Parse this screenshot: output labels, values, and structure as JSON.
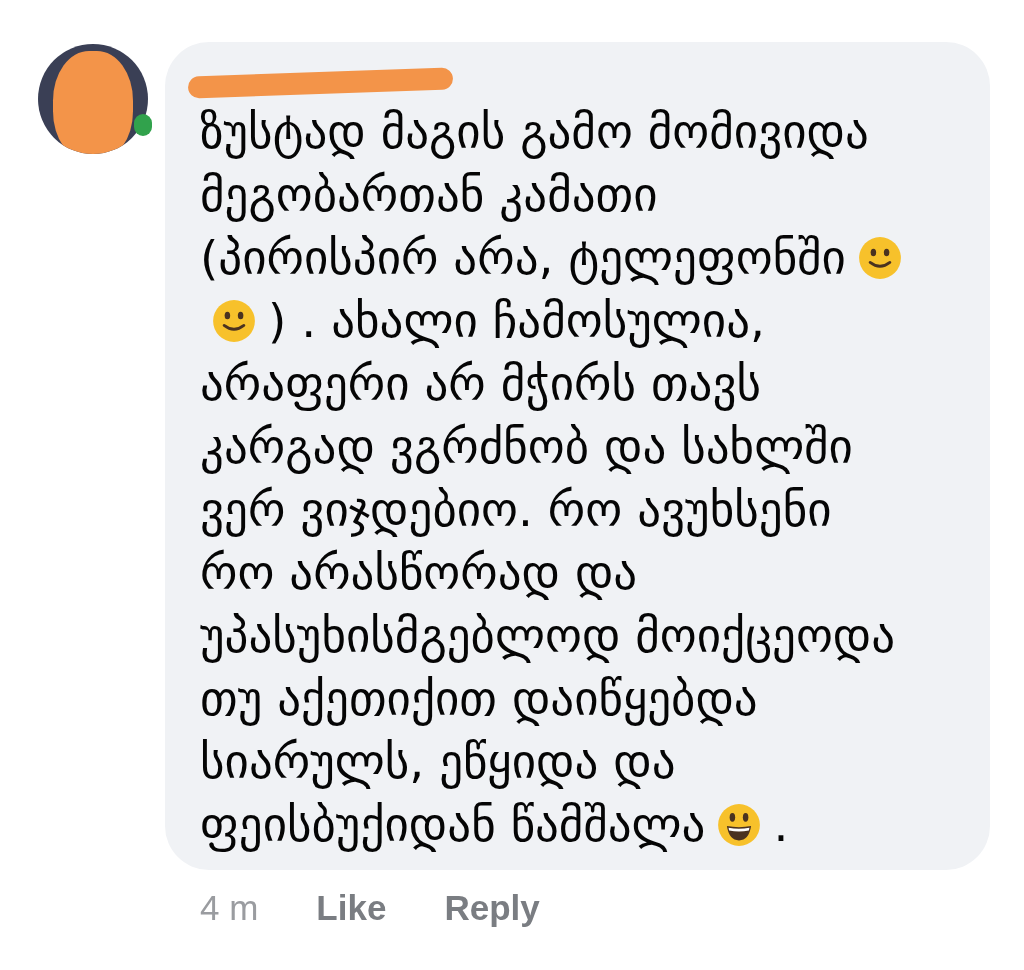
{
  "comment": {
    "author": {
      "online": true
    },
    "lines": [
      [
        {
          "kind": "text",
          "text": "ზუსტად მაგის გამო მომივიდა"
        }
      ],
      [
        {
          "kind": "text",
          "text": "მეგობართან კამათი"
        }
      ],
      [
        {
          "kind": "text",
          "text": "(პირისპირ არა, ტელეფონში"
        },
        {
          "kind": "smile"
        }
      ],
      [
        {
          "kind": "smile"
        },
        {
          "kind": "text",
          "text": ") . ახალი ჩამოსულია,"
        }
      ],
      [
        {
          "kind": "text",
          "text": "არაფერი არ მჭირს თავს"
        }
      ],
      [
        {
          "kind": "text",
          "text": "კარგად ვგრძნობ და სახლში"
        }
      ],
      [
        {
          "kind": "text",
          "text": "ვერ ვიჯდებიო. რო ავუხსენი"
        }
      ],
      [
        {
          "kind": "text",
          "text": "რო არასწორად და"
        }
      ],
      [
        {
          "kind": "text",
          "text": "უპასუხისმგებლოდ მოიქცეოდა"
        }
      ],
      [
        {
          "kind": "text",
          "text": "თუ აქეთიქით დაიწყებდა"
        }
      ],
      [
        {
          "kind": "text",
          "text": "სიარულს, ეწყიდა და"
        }
      ],
      [
        {
          "kind": "text",
          "text": "ფეისბუქიდან წამშალა"
        },
        {
          "kind": "grin"
        },
        {
          "kind": "text",
          "text": "."
        }
      ]
    ],
    "time": "4 m",
    "actions": [
      "Like",
      "Reply"
    ]
  }
}
